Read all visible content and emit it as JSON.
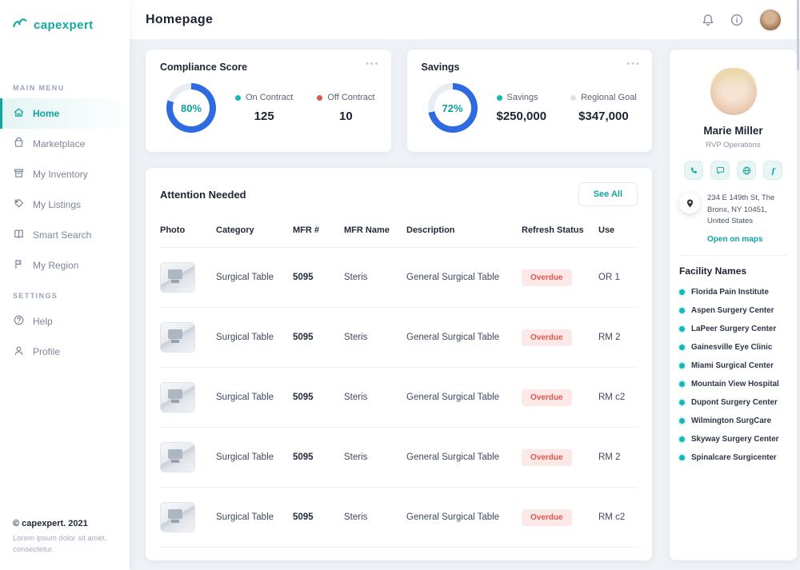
{
  "brand": {
    "name": "capexpert",
    "footer_copyright": "© capexpert. 2021",
    "footer_text": "Lorem ipsum dolor sit amet, consectetur."
  },
  "header": {
    "title": "Homepage"
  },
  "icons": {
    "card_menu": "•••"
  },
  "sidebar": {
    "main_menu_label": "MAIN MENU",
    "settings_label": "SETTINGS",
    "items": [
      {
        "label": "Home",
        "active": true
      },
      {
        "label": "Marketplace"
      },
      {
        "label": "My Inventory"
      },
      {
        "label": "My Listings"
      },
      {
        "label": "Smart Search"
      },
      {
        "label": "My Region"
      }
    ],
    "settings_items": [
      {
        "label": "Help"
      },
      {
        "label": "Profile"
      }
    ]
  },
  "chart_data": [
    {
      "type": "donut",
      "title": "Compliance Score",
      "percent": 80,
      "percent_label": "80%",
      "ring_color": "#2e6be0",
      "track_color": "#e8ecf3",
      "legend": [
        {
          "label": "On Contract",
          "value": "125",
          "color": "#14b8b4"
        },
        {
          "label": "Off Contract",
          "value": "10",
          "color": "#e2574c"
        }
      ]
    },
    {
      "type": "donut",
      "title": "Savings",
      "percent": 72,
      "percent_label": "72%",
      "ring_color": "#2e6be0",
      "track_color": "#e8ecf3",
      "legend": [
        {
          "label": "Savings",
          "value": "$250,000",
          "color": "#14b8b4"
        },
        {
          "label": "Regional Goal",
          "value": "$347,000",
          "color": "#dde2ea"
        }
      ]
    }
  ],
  "attention": {
    "title": "Attention Needed",
    "see_all": "See All",
    "columns": [
      "Photo",
      "Category",
      "MFR #",
      "MFR Name",
      "Description",
      "Refresh Status",
      "Use"
    ],
    "rows": [
      {
        "category": "Surgical Table",
        "mfr_number": "5095",
        "mfr_name": "Steris",
        "description": "General Surgical Table",
        "status": "Overdue",
        "use": "OR 1"
      },
      {
        "category": "Surgical Table",
        "mfr_number": "5095",
        "mfr_name": "Steris",
        "description": "General Surgical Table",
        "status": "Overdue",
        "use": "RM 2"
      },
      {
        "category": "Surgical Table",
        "mfr_number": "5095",
        "mfr_name": "Steris",
        "description": "General Surgical Table",
        "status": "Overdue",
        "use": "RM c2"
      },
      {
        "category": "Surgical Table",
        "mfr_number": "5095",
        "mfr_name": "Steris",
        "description": "General Surgical Table",
        "status": "Overdue",
        "use": "RM 2"
      },
      {
        "category": "Surgical Table",
        "mfr_number": "5095",
        "mfr_name": "Steris",
        "description": "General Surgical Table",
        "status": "Overdue",
        "use": "RM c2"
      }
    ]
  },
  "profile": {
    "name": "Marie Miller",
    "role": "RVP Operations",
    "address": "234 E 149th St, The Bronx, NY 10451, United States",
    "maps_link": "Open on maps",
    "facilities_title": "Facility Names",
    "facilities": [
      "Florida Pain Institute",
      "Aspen Surgery Center",
      "LaPeer Surgery Center",
      "Gainesville Eye Clinic",
      "Miami Surgical Center",
      "Mountain View Hospital",
      "Dupont Surgery Center",
      "Wilmington SurgCare",
      "Skyway Surgery Center",
      "Spinalcare Surgicenter"
    ]
  }
}
